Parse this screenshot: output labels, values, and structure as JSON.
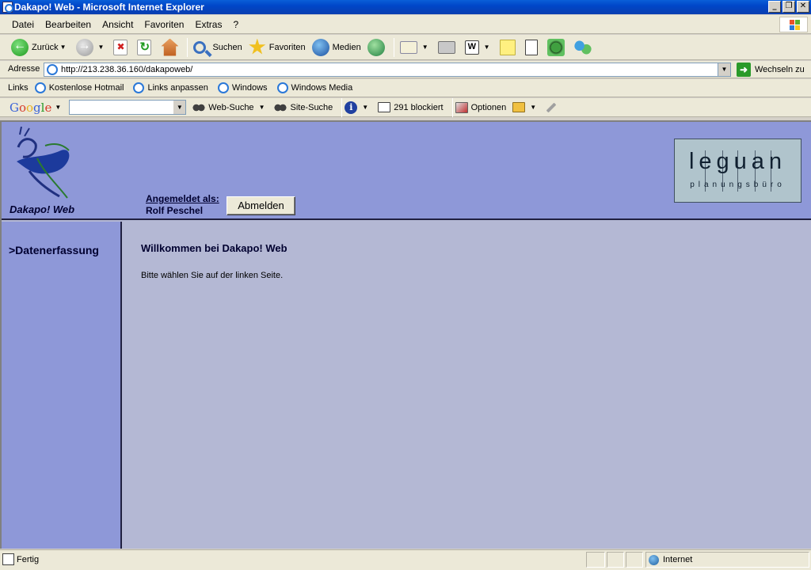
{
  "window": {
    "title": "Dakapo! Web - Microsoft Internet Explorer"
  },
  "menu": [
    "Datei",
    "Bearbeiten",
    "Ansicht",
    "Favoriten",
    "Extras",
    "?"
  ],
  "toolbar": {
    "back": "Zurück",
    "search": "Suchen",
    "favorites": "Favoriten",
    "media": "Medien"
  },
  "address": {
    "label": "Adresse",
    "url": "http://213.238.36.160/dakapoweb/",
    "go": "Wechseln zu"
  },
  "links": {
    "label": "Links",
    "items": [
      "Kostenlose Hotmail",
      "Links anpassen",
      "Windows",
      "Windows Media"
    ]
  },
  "google": {
    "logo": "Google",
    "web_search": "Web-Suche",
    "site_search": "Site-Suche",
    "blocked": "291 blockiert",
    "options": "Optionen"
  },
  "page": {
    "app_title": "Dakapo! Web",
    "login_label": "Angemeldet als:",
    "login_user": "Rolf Peschel",
    "logout": "Abmelden",
    "brand_word": "leguan",
    "brand_sub": "planungsbüro",
    "nav": [
      ">Datenerfassung"
    ],
    "welcome": "Willkommen bei Dakapo! Web",
    "hint": "Bitte wählen Sie auf der linken Seite."
  },
  "colors": {
    "header_bg": "#8e98d8",
    "content_bg": "#b4b8d4",
    "brand_box": "#b0c4cc"
  },
  "status": {
    "text": "Fertig",
    "zone": "Internet"
  }
}
